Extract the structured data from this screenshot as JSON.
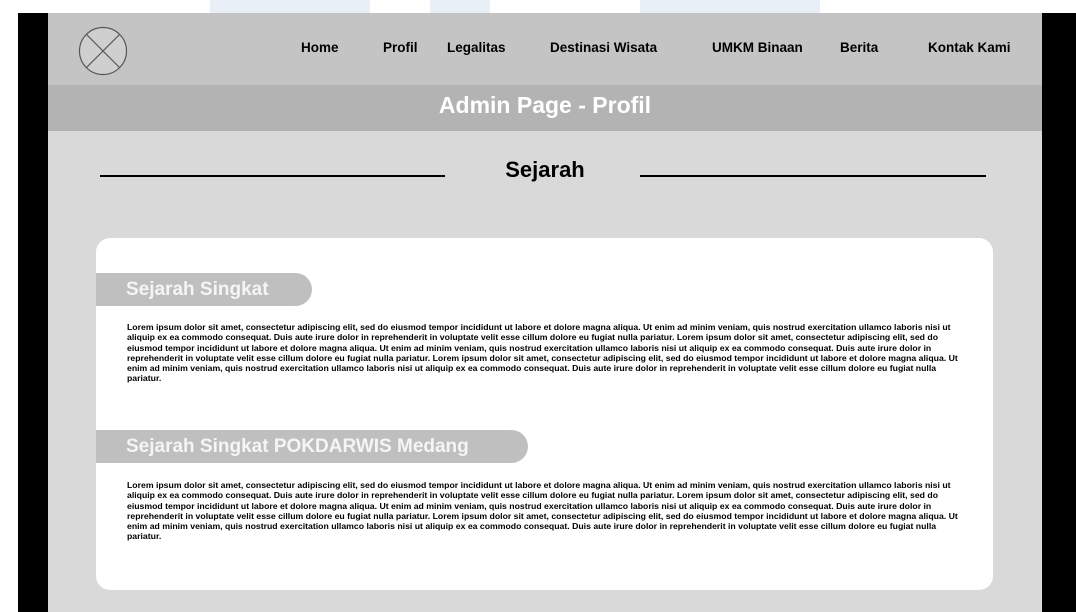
{
  "nav": {
    "logo_icon": "image-placeholder-icon",
    "items": [
      {
        "label": "Home"
      },
      {
        "label": "Profil"
      },
      {
        "label": "Legalitas"
      },
      {
        "label": "Destinasi Wisata"
      },
      {
        "label": "UMKM Binaan"
      },
      {
        "label": "Berita"
      },
      {
        "label": "Kontak Kami"
      }
    ]
  },
  "admin_bar": {
    "title": "Admin Page - Profil"
  },
  "section": {
    "heading": "Sejarah"
  },
  "card": {
    "blocks": [
      {
        "title": "Sejarah Singkat",
        "text": "Lorem ipsum dolor sit amet, consectetur adipiscing elit, sed do eiusmod tempor incididunt ut labore et dolore magna aliqua. Ut enim ad minim veniam, quis nostrud exercitation ullamco laboris nisi ut aliquip ex ea commodo consequat. Duis aute irure dolor in reprehenderit in voluptate velit esse cillum dolore eu fugiat nulla pariatur. Lorem ipsum dolor sit amet, consectetur adipiscing elit, sed do eiusmod tempor incididunt ut labore et dolore magna aliqua. Ut enim ad minim veniam, quis nostrud exercitation ullamco laboris nisi ut aliquip ex ea commodo consequat. Duis aute irure dolor in reprehenderit in voluptate velit esse cillum dolore eu fugiat nulla pariatur. Lorem ipsum dolor sit amet, consectetur adipiscing elit, sed do eiusmod tempor incididunt ut labore et dolore magna aliqua. Ut enim ad minim veniam, quis nostrud exercitation ullamco laboris nisi ut aliquip ex ea commodo consequat. Duis aute irure dolor in reprehenderit in voluptate velit esse cillum dolore eu fugiat nulla pariatur."
      },
      {
        "title": "Sejarah Singkat POKDARWIS Medang",
        "text": "Lorem ipsum dolor sit amet, consectetur adipiscing elit, sed do eiusmod tempor incididunt ut labore et dolore magna aliqua. Ut enim ad minim veniam, quis nostrud exercitation ullamco laboris nisi ut aliquip ex ea commodo consequat. Duis aute irure dolor in reprehenderit in voluptate velit esse cillum dolore eu fugiat nulla pariatur. Lorem ipsum dolor sit amet, consectetur adipiscing elit, sed do eiusmod tempor incididunt ut labore et dolore magna aliqua. Ut enim ad minim veniam, quis nostrud exercitation ullamco laboris nisi ut aliquip ex ea commodo consequat. Duis aute irure dolor in reprehenderit in voluptate velit esse cillum dolore eu fugiat nulla pariatur. Lorem ipsum dolor sit amet, consectetur adipiscing elit, sed do eiusmod tempor incididunt ut labore et dolore magna aliqua. Ut enim ad minim veniam, quis nostrud exercitation ullamco laboris nisi ut aliquip ex ea commodo consequat. Duis aute irure dolor in reprehenderit in voluptate velit esse cillum dolore eu fugiat nulla pariatur."
      }
    ]
  },
  "colors": {
    "frame": "#000000",
    "page_bg": "#d9d9d9",
    "navbar_bg": "#c4c4c4",
    "admin_bar_bg": "#b3b3b3",
    "card_bg": "#ffffff",
    "pill_bg": "#bfbfbf"
  }
}
